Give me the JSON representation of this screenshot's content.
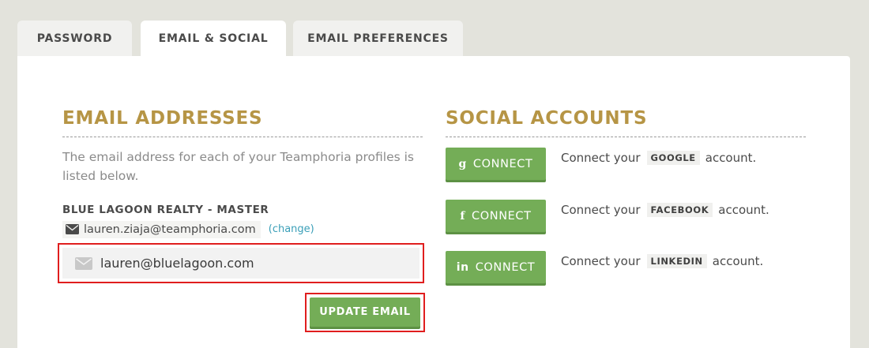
{
  "tabs": {
    "password": "PASSWORD",
    "email_social": "EMAIL & SOCIAL",
    "email_preferences": "EMAIL PREFERENCES",
    "active": "email_social"
  },
  "email_section": {
    "title": "EMAIL ADDRESSES",
    "description": "The email address for each of your Teamphoria profiles is listed below.",
    "profile_name": "BLUE LAGOON REALTY - MASTER",
    "current_email": "lauren.ziaja@teamphoria.com",
    "change_label": "(change)",
    "input_value": "lauren@bluelagoon.com",
    "update_button": "UPDATE EMAIL",
    "icon": "envelope-icon"
  },
  "social_section": {
    "title": "SOCIAL ACCOUNTS",
    "accounts": [
      {
        "glyph": "g",
        "button": "CONNECT",
        "prefix": "Connect your",
        "provider": "GOOGLE",
        "suffix": "account.",
        "icon": "google-icon"
      },
      {
        "glyph": "f",
        "button": "CONNECT",
        "prefix": "Connect your",
        "provider": "FACEBOOK",
        "suffix": "account.",
        "icon": "facebook-icon"
      },
      {
        "glyph": "in",
        "button": "CONNECT",
        "prefix": "Connect your",
        "provider": "LINKEDIN",
        "suffix": "account.",
        "icon": "linkedin-icon"
      }
    ]
  },
  "colors": {
    "accent_gold": "#b69545",
    "button_green": "#74ad57",
    "link_blue": "#3a9fb8",
    "highlight_red": "#e01e1e",
    "background": "#e3e3dc"
  }
}
